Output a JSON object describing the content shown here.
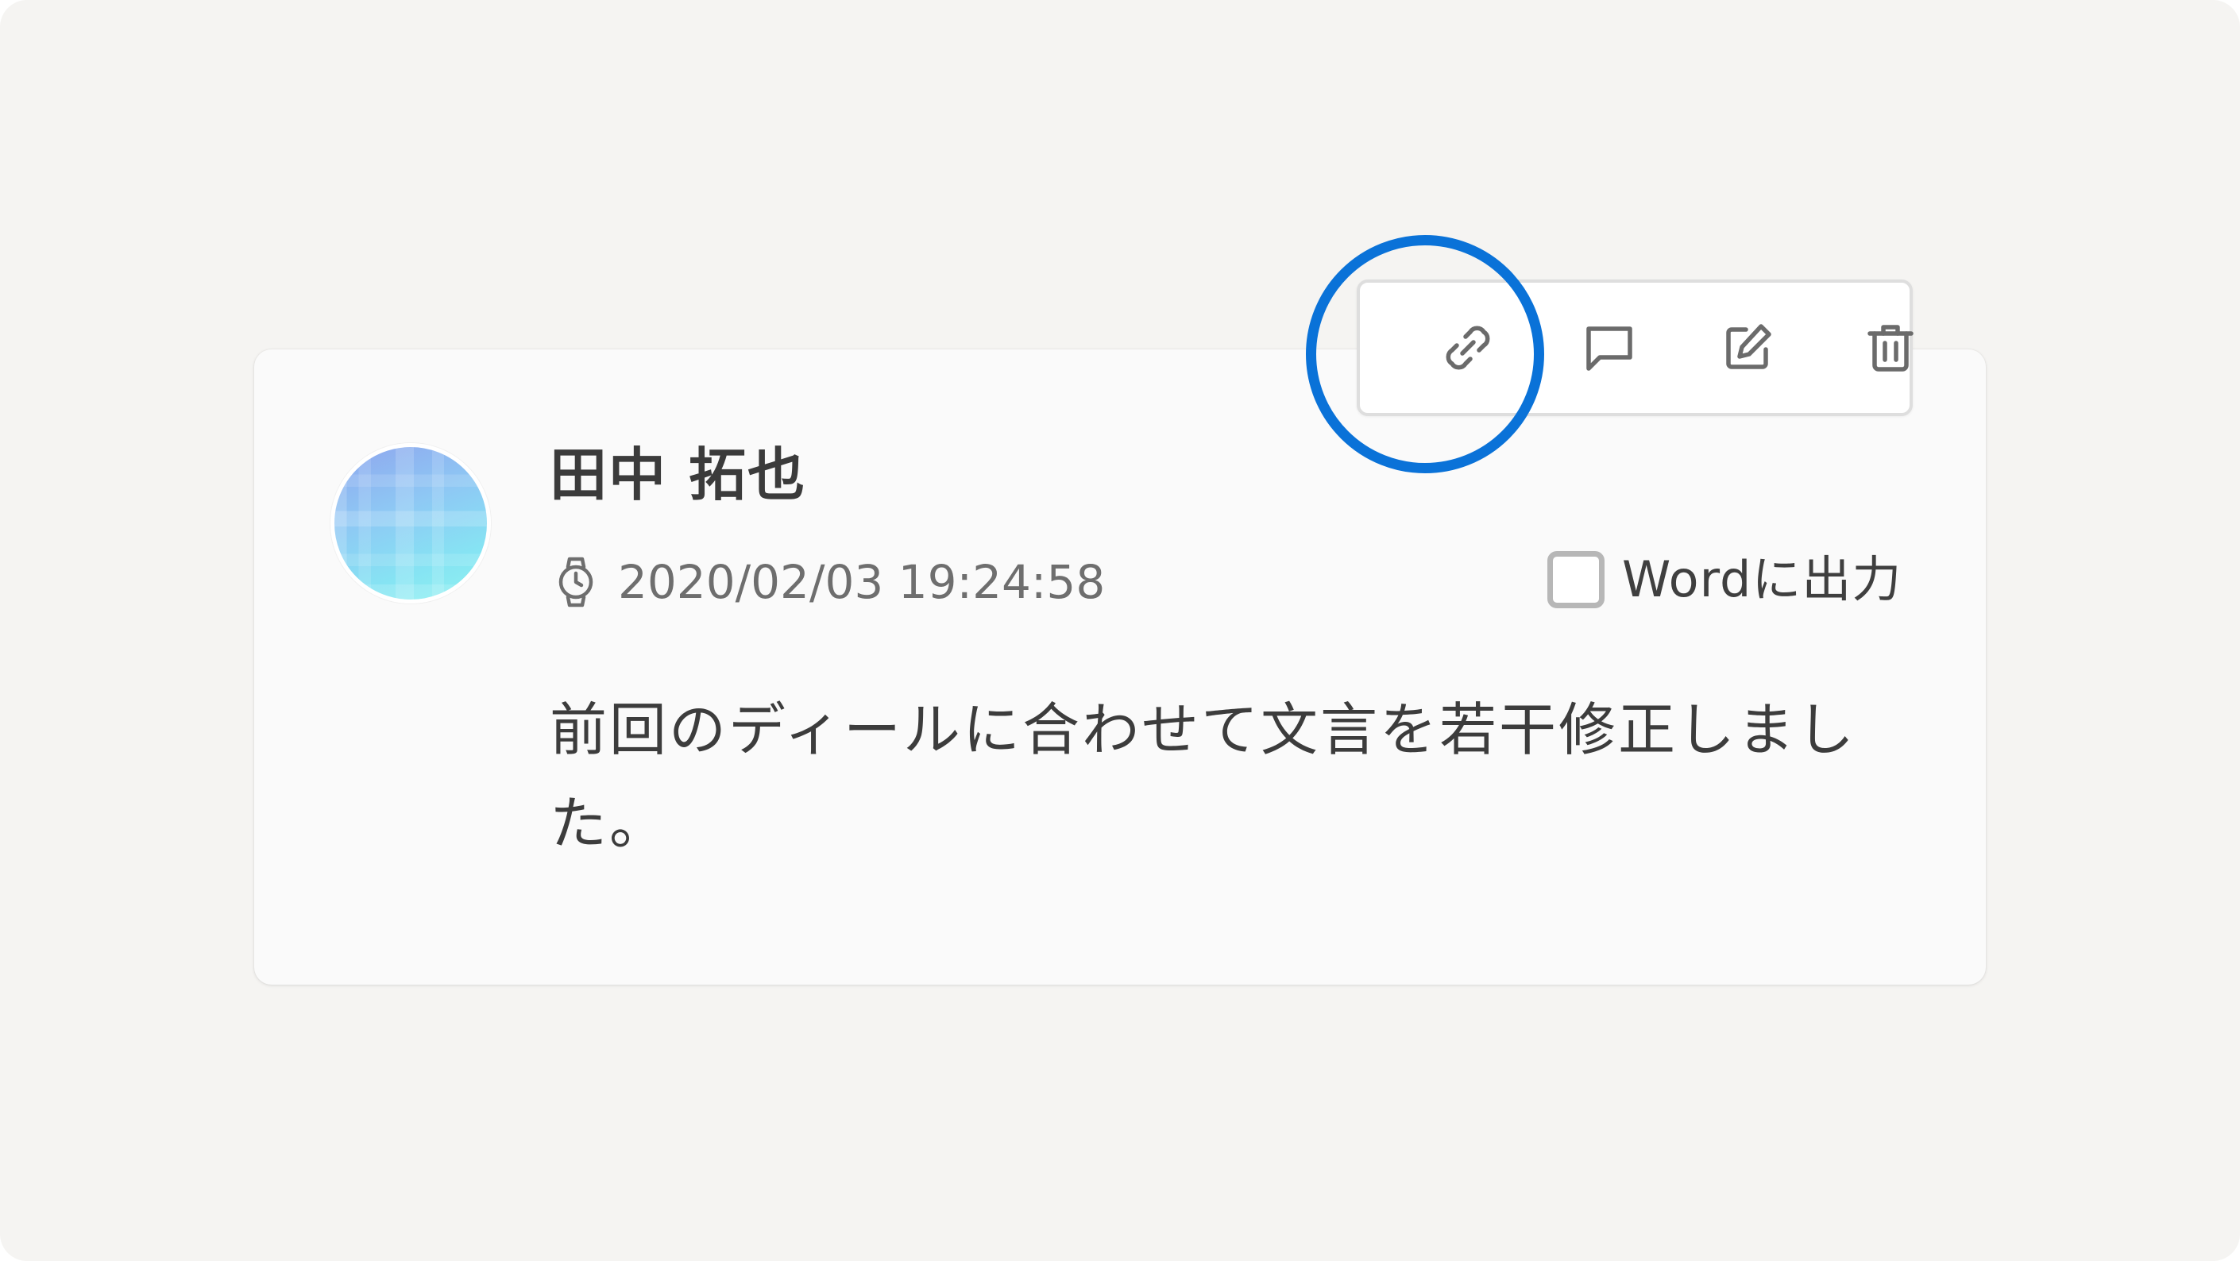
{
  "comment": {
    "author_name": "田中 拓也",
    "timestamp": "2020/02/03 19:24:58",
    "body": "前回のディールに合わせて文言を若干修正しました。",
    "word_export": {
      "label": "Wordに出力",
      "checked": false
    }
  },
  "toolbar": {
    "actions": [
      {
        "icon": "link-icon"
      },
      {
        "icon": "reply-icon"
      },
      {
        "icon": "edit-icon"
      },
      {
        "icon": "trash-icon"
      }
    ]
  },
  "colors": {
    "highlight": "#0a72d8",
    "icon": "#6b6b6b",
    "background": "#f5f4f2",
    "card": "#fafafa",
    "checkbox_border": "#b7b7b7"
  }
}
